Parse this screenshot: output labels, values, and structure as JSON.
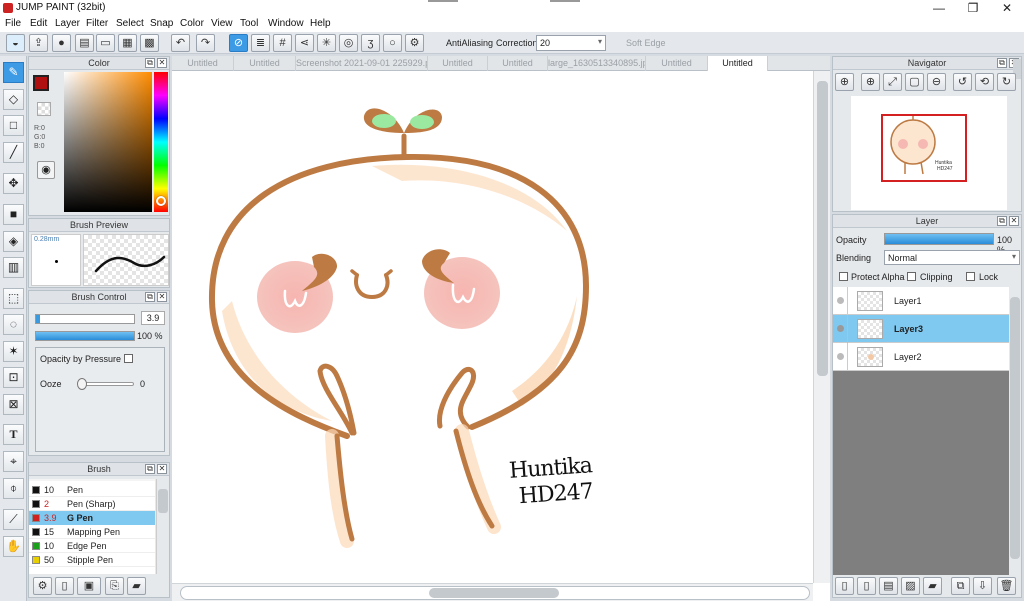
{
  "app": {
    "title": "JUMP PAINT (32bit)"
  },
  "window_controls": {
    "minimize": "—",
    "maximize": "❐",
    "close": "✕"
  },
  "menu": [
    "File",
    "Edit",
    "Layer",
    "Filter",
    "Select",
    "Snap",
    "Color",
    "View",
    "Tool",
    "Window",
    "Help"
  ],
  "toolbar": {
    "antialiasing_label": "AntiAliasing",
    "correction_label": "Correction",
    "correction_value": "20",
    "soft_edge_label": "Soft Edge"
  },
  "color_panel": {
    "title": "Color",
    "foreground": "#b01010",
    "r": "R:0",
    "g": "G:0",
    "b": "B:0"
  },
  "brush_preview": {
    "title": "Brush Preview",
    "size": "0.28mm"
  },
  "brush_control": {
    "title": "Brush Control",
    "size_value": "3.9",
    "opacity_value": "100 %",
    "opacity_by_pressure": "Opacity by Pressure",
    "ooze_label": "Ooze",
    "ooze_value": "0"
  },
  "brush_panel": {
    "title": "Brush",
    "items": [
      {
        "size": "10",
        "name": "Pen",
        "color": "#111111"
      },
      {
        "size": "2",
        "name": "Pen (Sharp)",
        "color": "#111111"
      },
      {
        "size": "3.9",
        "name": "G Pen",
        "color": "#d02020"
      },
      {
        "size": "15",
        "name": "Mapping Pen",
        "color": "#111111"
      },
      {
        "size": "10",
        "name": "Edge Pen",
        "color": "#1aa01a"
      },
      {
        "size": "50",
        "name": "Stipple Pen",
        "color": "#e8d000"
      }
    ]
  },
  "tabs": [
    "Untitled",
    "Untitled",
    "Screenshot 2021-09-01 225929.png",
    "Untitled",
    "Untitled",
    "large_1630513340895.jpg",
    "Untitled",
    "Untitled"
  ],
  "navigator": {
    "title": "Navigator"
  },
  "layer_panel": {
    "title": "Layer",
    "opacity_label": "Opacity",
    "opacity_value": "100 %",
    "blending_label": "Blending",
    "blending_value": "Normal",
    "protect_alpha": "Protect Alpha",
    "clipping": "Clipping",
    "lock": "Lock",
    "layers": [
      {
        "name": "Layer1"
      },
      {
        "name": "Layer3"
      },
      {
        "name": "Layer2"
      }
    ]
  },
  "drawing": {
    "signature_line1": "Huntika",
    "signature_line2": "HD247"
  }
}
